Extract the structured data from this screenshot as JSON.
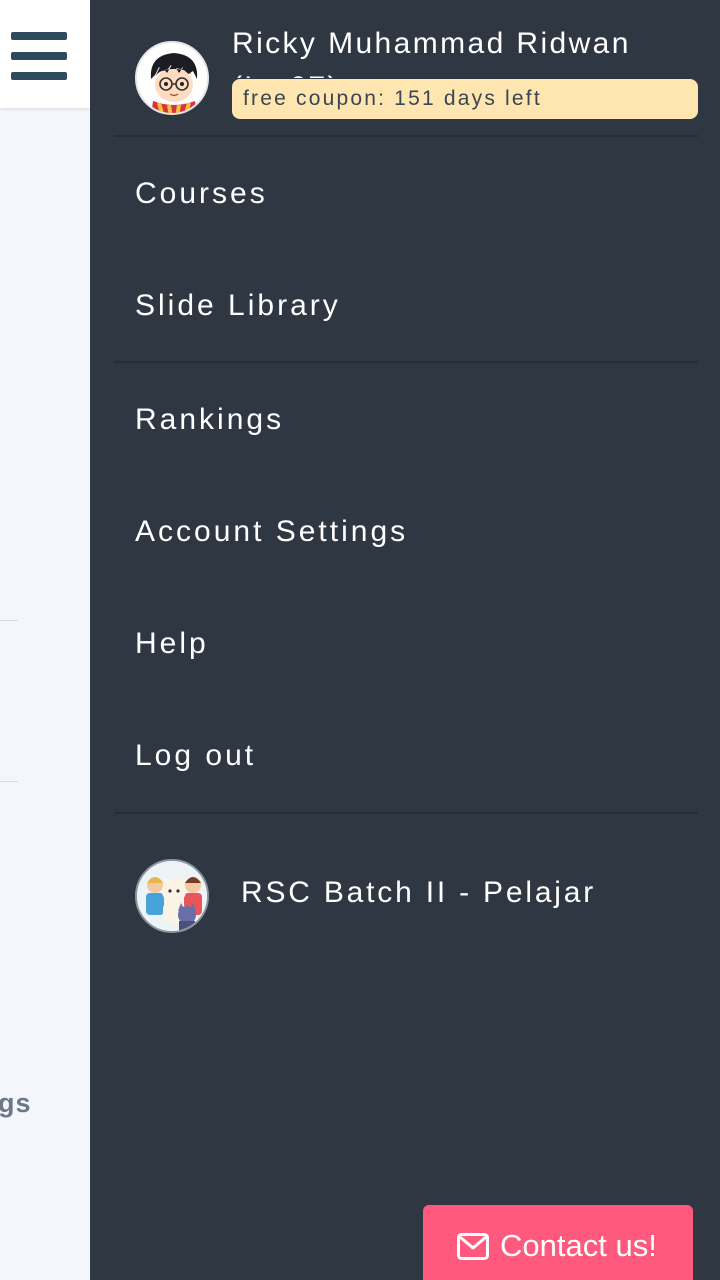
{
  "background_page": {
    "partial_text": "gs"
  },
  "drawer": {
    "profile": {
      "name": "Ricky Muhammad Ridwan (Lv.67)",
      "coupon": "free coupon: 151 days left"
    },
    "menu_items": [
      {
        "label": "Courses"
      },
      {
        "label": "Slide Library"
      },
      {
        "label": "Rankings"
      },
      {
        "label": "Account Settings"
      },
      {
        "label": "Help"
      },
      {
        "label": "Log out"
      }
    ],
    "group": {
      "label": "RSC Batch II - Pelajar"
    }
  },
  "contact": {
    "label": "Contact us!",
    "icon": "envelope-icon"
  },
  "colors": {
    "drawer_background": "#2f3742",
    "coupon_badge": "#ffe6b0",
    "contact_button": "#ff5a7e",
    "hamburger": "#2e4a5c"
  }
}
